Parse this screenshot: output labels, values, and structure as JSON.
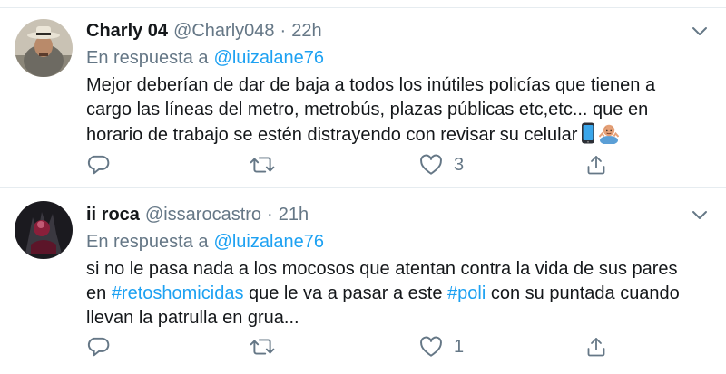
{
  "tweets": [
    {
      "display_name": "Charly 04",
      "handle": "@Charly048",
      "separator": "·",
      "time": "22h",
      "reply_prefix": "En respuesta a",
      "reply_to": "@luizalane76",
      "text_lines": [
        "Mejor deberían de dar de baja a todos los inútiles policías que tienen a",
        "cargo las líneas del metro, metrobús, plazas públicas etc,etc... que en",
        "horario de trabajo se estén distrayendo con revisar su celular"
      ],
      "emojis": [
        "mobile-phone-icon",
        "person-shrugging-icon"
      ],
      "like_count": "3"
    },
    {
      "display_name": "ii roca",
      "handle": "@issarocastro",
      "separator": "·",
      "time": "21h",
      "reply_prefix": "En respuesta a",
      "reply_to": "@luizalane76",
      "text": {
        "line1": "si no le pasa nada a los mocosos que atentan contra la vida de sus pares",
        "line2_pre": "en ",
        "hashtag1": "#retoshomicidas",
        "line2_mid": " que le va a pasar a este ",
        "hashtag2": "#poli",
        "line2_post": " con su puntada cuando",
        "line3": "llevan la patrulla en grua..."
      },
      "like_count": "1"
    }
  ],
  "colors": {
    "text": "#14171a",
    "secondary": "#657786",
    "link": "#1da1f2",
    "divider": "#e6ecf0"
  },
  "icons": [
    "reply-icon",
    "retweet-icon",
    "like-icon",
    "share-icon",
    "caret-down-icon"
  ]
}
